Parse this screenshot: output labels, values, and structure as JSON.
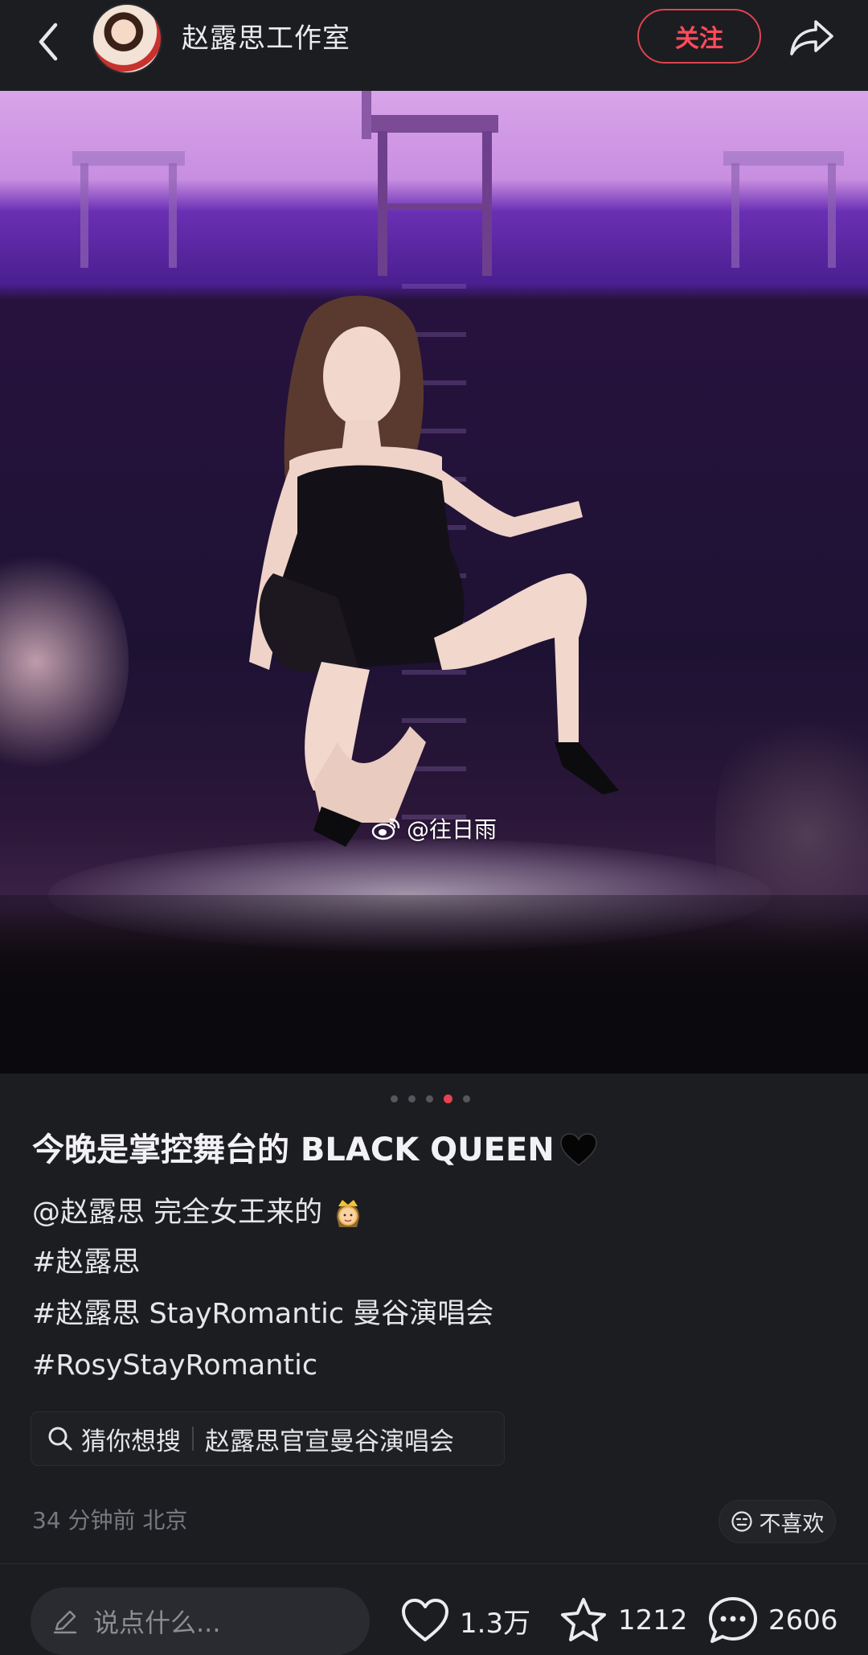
{
  "header": {
    "account_name": "赵露思工作室",
    "follow_label": "关注"
  },
  "photo": {
    "watermark": "@往日雨",
    "total_pages": 5,
    "current_page": 4
  },
  "post": {
    "title": "今晚是掌控舞台的 BLACK QUEEN",
    "lines": [
      "@赵露思 完全女王来的",
      "#赵露思",
      "#赵露思 StayRomantic 曼谷演唱会",
      "#RosyStayRomantic"
    ]
  },
  "search_suggestion": {
    "label": "猜你想搜",
    "query": "赵露思官宣曼谷演唱会"
  },
  "meta": {
    "time_location": "34 分钟前  北京",
    "dislike_label": "不喜欢"
  },
  "bottom_bar": {
    "comment_placeholder": "说点什么...",
    "likes": "1.3万",
    "favorites": "1212",
    "comments": "2606"
  },
  "colors": {
    "accent": "#ff4b5a",
    "background": "#1c1d21"
  }
}
